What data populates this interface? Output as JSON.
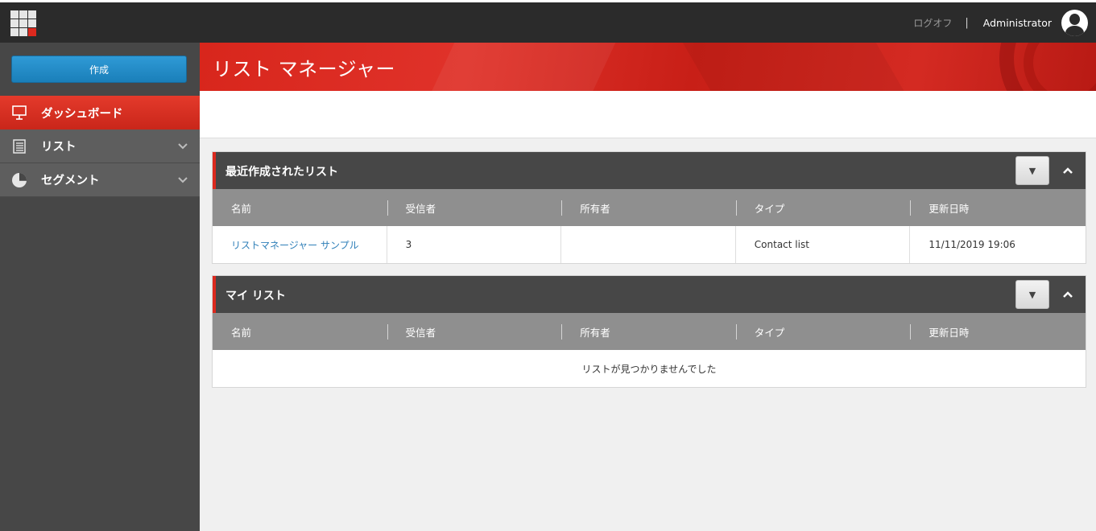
{
  "topbar": {
    "logoff_label": "ログオフ",
    "separator": "|",
    "user_name": "Administrator"
  },
  "sidebar": {
    "create_label": "作成",
    "items": [
      {
        "label": "ダッシュボード",
        "icon": "presentation-board-icon",
        "active": true
      },
      {
        "label": "リスト",
        "icon": "list-icon",
        "expandable": true
      },
      {
        "label": "セグメント",
        "icon": "pie-chart-icon",
        "expandable": true
      }
    ]
  },
  "header": {
    "title": "リスト マネージャー"
  },
  "recent_panel": {
    "title": "最近作成されたリスト",
    "columns": [
      "名前",
      "受信者",
      "所有者",
      "タイプ",
      "更新日時"
    ],
    "rows": [
      {
        "name": "リストマネージャー サンプル",
        "recipients": "3",
        "owner": "",
        "type": "Contact list",
        "updated": "11/11/2019 19:06"
      }
    ]
  },
  "my_panel": {
    "title": "マイ リスト",
    "columns": [
      "名前",
      "受信者",
      "所有者",
      "タイプ",
      "更新日時"
    ],
    "empty_message": "リストが見つかりませんでした"
  },
  "colors": {
    "accent_red": "#dc291e",
    "button_blue": "#1a7fb9",
    "link_blue": "#2f7fb8",
    "topbar": "#2b2b2b",
    "sidebar": "#474747"
  }
}
